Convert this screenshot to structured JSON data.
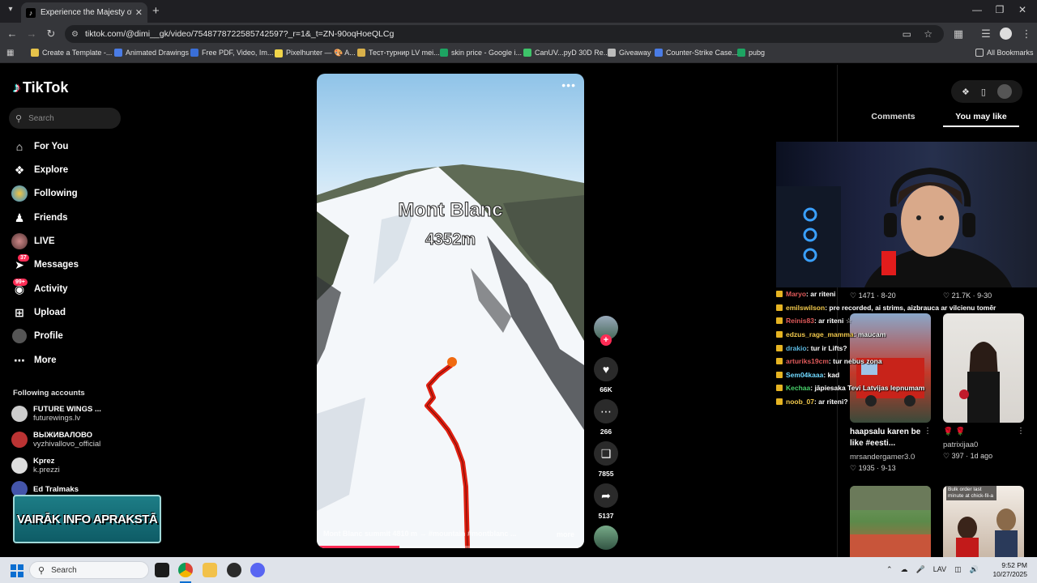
{
  "browser": {
    "tab_title": "Experience the Majesty of Mont Blanc",
    "url": "tiktok.com/@dimi__gk/video/7548778722585742597?_r=1&_t=ZN-90oqHoeQLCg",
    "bookmarks": [
      {
        "label": "Create a Template -...",
        "color": "#e6c34a"
      },
      {
        "label": "Animated Drawings",
        "color": "#4a7ce6"
      },
      {
        "label": "Free PDF, Video, Im...",
        "color": "#3a6fd8"
      },
      {
        "label": "Pixelhunter — 🎨 A...",
        "color": "#f1d54a"
      },
      {
        "label": "Тест-турнир LV mei...",
        "color": "#d8b04a"
      },
      {
        "label": "skin price - Google i...",
        "color": "#1da462"
      },
      {
        "label": "CanUV...pyD 30D Re...",
        "color": "#3ec46a"
      },
      {
        "label": "Giveaway",
        "color": "#bbbbbb"
      },
      {
        "label": "Counter-Strike Case...",
        "color": "#4a7ce6"
      },
      {
        "label": "pubg",
        "color": "#1da462"
      }
    ],
    "all_bookmarks": "All Bookmarks"
  },
  "sidebar": {
    "logo": "TikTok",
    "search_placeholder": "Search",
    "nav": [
      {
        "label": "For You",
        "icon": "home-icon"
      },
      {
        "label": "Explore",
        "icon": "compass-icon"
      },
      {
        "label": "Following",
        "icon": "following-avatar-icon"
      },
      {
        "label": "Friends",
        "icon": "friends-icon"
      },
      {
        "label": "LIVE",
        "icon": "live-icon"
      },
      {
        "label": "Messages",
        "icon": "messages-icon",
        "badge": "37"
      },
      {
        "label": "Activity",
        "icon": "activity-icon",
        "badge": "99+"
      },
      {
        "label": "Upload",
        "icon": "upload-icon"
      },
      {
        "label": "Profile",
        "icon": "profile-avatar-icon"
      },
      {
        "label": "More",
        "icon": "more-dots-icon"
      }
    ],
    "following_heading": "Following accounts",
    "accounts": [
      {
        "name": "FUTURE WINGS ...",
        "handle": "futurewings.lv"
      },
      {
        "name": "ВЫЖИВАЛОВО",
        "handle": "vyzhivallovo_official"
      },
      {
        "name": "Kprez",
        "handle": "k.prezzi"
      },
      {
        "name": "Ed Tralmaks",
        "handle": ""
      }
    ],
    "promo_banner": "VAIRĀK INFO APRAKSTĀ"
  },
  "video": {
    "overlay_title": "Mont Blanc",
    "overlay_altitude": "4352m",
    "caption": "Mont Blanc summit 4810 m → #mountain #montblanc ...",
    "more_label": "more",
    "progress": 0.31
  },
  "actions": {
    "likes": "66K",
    "comments": "266",
    "saves": "7855",
    "shares": "5137"
  },
  "right_panel": {
    "tab_comments": "Comments",
    "tab_you_may_like": "You may like",
    "top_stats": [
      {
        "likes": "1471",
        "date": "8-20"
      },
      {
        "likes": "21.7K",
        "date": "9-30"
      }
    ],
    "cards": [
      {
        "title": "haapsalu karen be like #eesti...",
        "user": "mrsandergamer3.0",
        "likes": "1935",
        "date": "9-13"
      },
      {
        "title": "🌹 🌹",
        "user": "patrixijaa0",
        "likes": "397",
        "date": "1d ago"
      },
      {
        "title": "",
        "user": "",
        "likes": "",
        "date": ""
      },
      {
        "title": "Bulk order last minute at chick-fil-a",
        "user": "",
        "likes": "",
        "date": ""
      }
    ]
  },
  "chat": [
    {
      "user": "Maryo",
      "msg": ": ar riteni",
      "color": "#e05a5a"
    },
    {
      "user": "emilswilson",
      "msg": ": pre recorded, ai strims, aizbrauca ar vilcienu tomēr",
      "color": "#f2c94c"
    },
    {
      "user": "Reinis83",
      "msg": ": ar riteni ☆",
      "color": "#e05a5a"
    },
    {
      "user": "edzus_rage_mamma",
      "msg": ": maucam",
      "color": "#f2c94c"
    },
    {
      "user": "drakio",
      "msg": ": tur ir Lifts?",
      "color": "#5ab8e0"
    },
    {
      "user": "arturiks19cm",
      "msg": ": tur nebus zona",
      "color": "#e05a5a"
    },
    {
      "user": "Sem04kaaa",
      "msg": ": kad",
      "color": "#6fd8ff"
    },
    {
      "user": "Kechaa",
      "msg": ": jāpiesaka Tevi Latvijas lepnumam",
      "color": "#48d06a"
    },
    {
      "user": "noob_07",
      "msg": ": ar riteni?",
      "color": "#f2c94c"
    }
  ],
  "taskbar": {
    "search_placeholder": "Search",
    "lang": "LAV",
    "time": "9:52 PM",
    "date": "10/27/2025"
  }
}
